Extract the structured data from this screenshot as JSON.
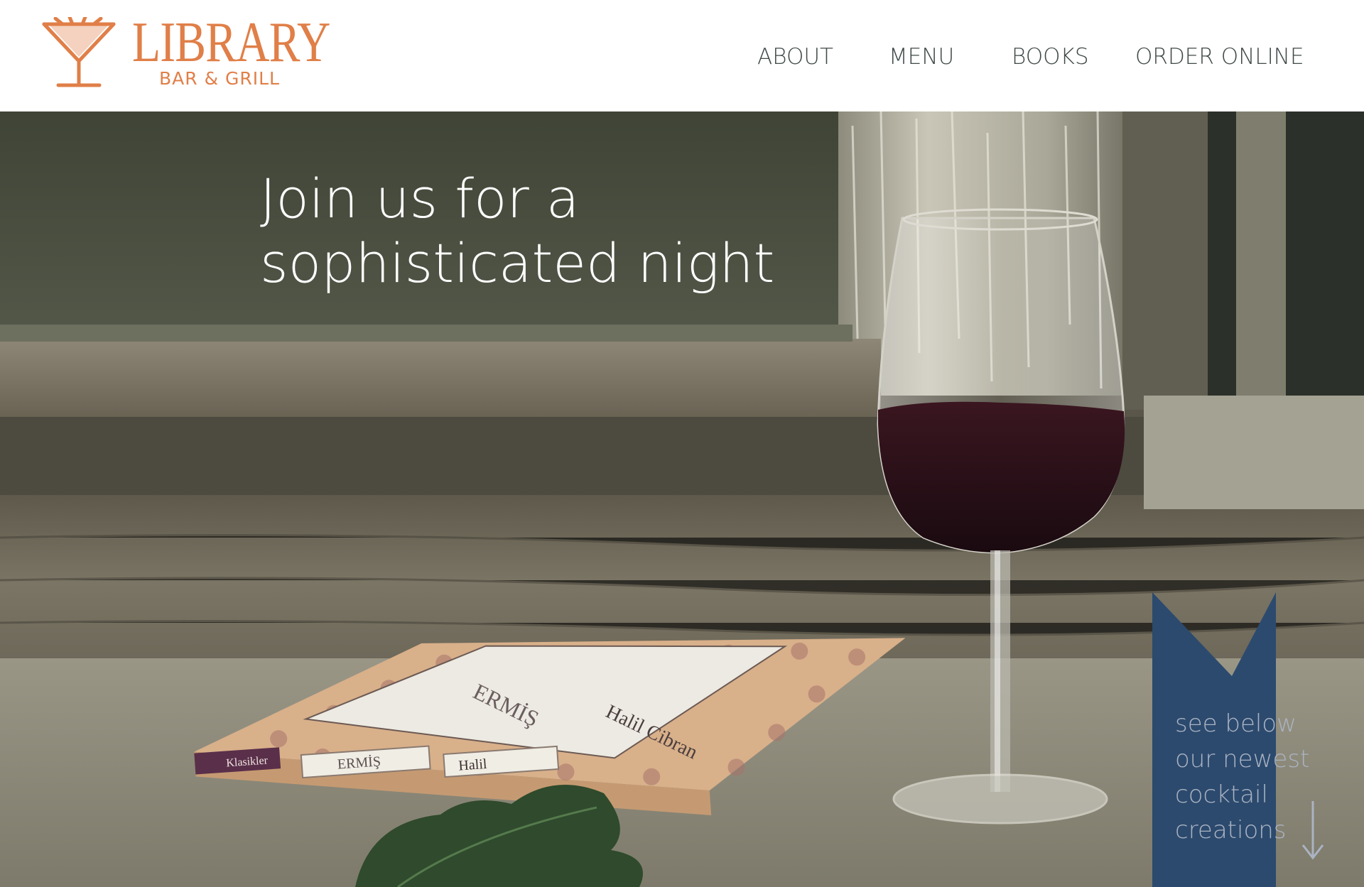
{
  "brand": {
    "name": "LIBRARY",
    "tagline": "BAR & GRILL",
    "accent_color": "#e07f48",
    "logo_icon": "cocktail-glass-icon"
  },
  "nav": {
    "items": [
      {
        "label": "ABOUT"
      },
      {
        "label": "MENU"
      },
      {
        "label": "BOOKS"
      },
      {
        "label": "ORDER ONLINE"
      }
    ],
    "text_color": "#3f4848"
  },
  "hero": {
    "headline_line1": "Join us for a",
    "headline_line2": "sophisticated night",
    "book": {
      "title": "ERMİŞ",
      "author": "Halil Cibran",
      "series": "Klasikler",
      "spine_title": "ERMİŞ",
      "spine_author": "Halil"
    }
  },
  "ribbon": {
    "line1": "see below",
    "line2": "our newest",
    "line3": "cocktail",
    "line4": "creations",
    "arrow_icon": "arrow-down-icon",
    "color": "#2c4a6e"
  }
}
